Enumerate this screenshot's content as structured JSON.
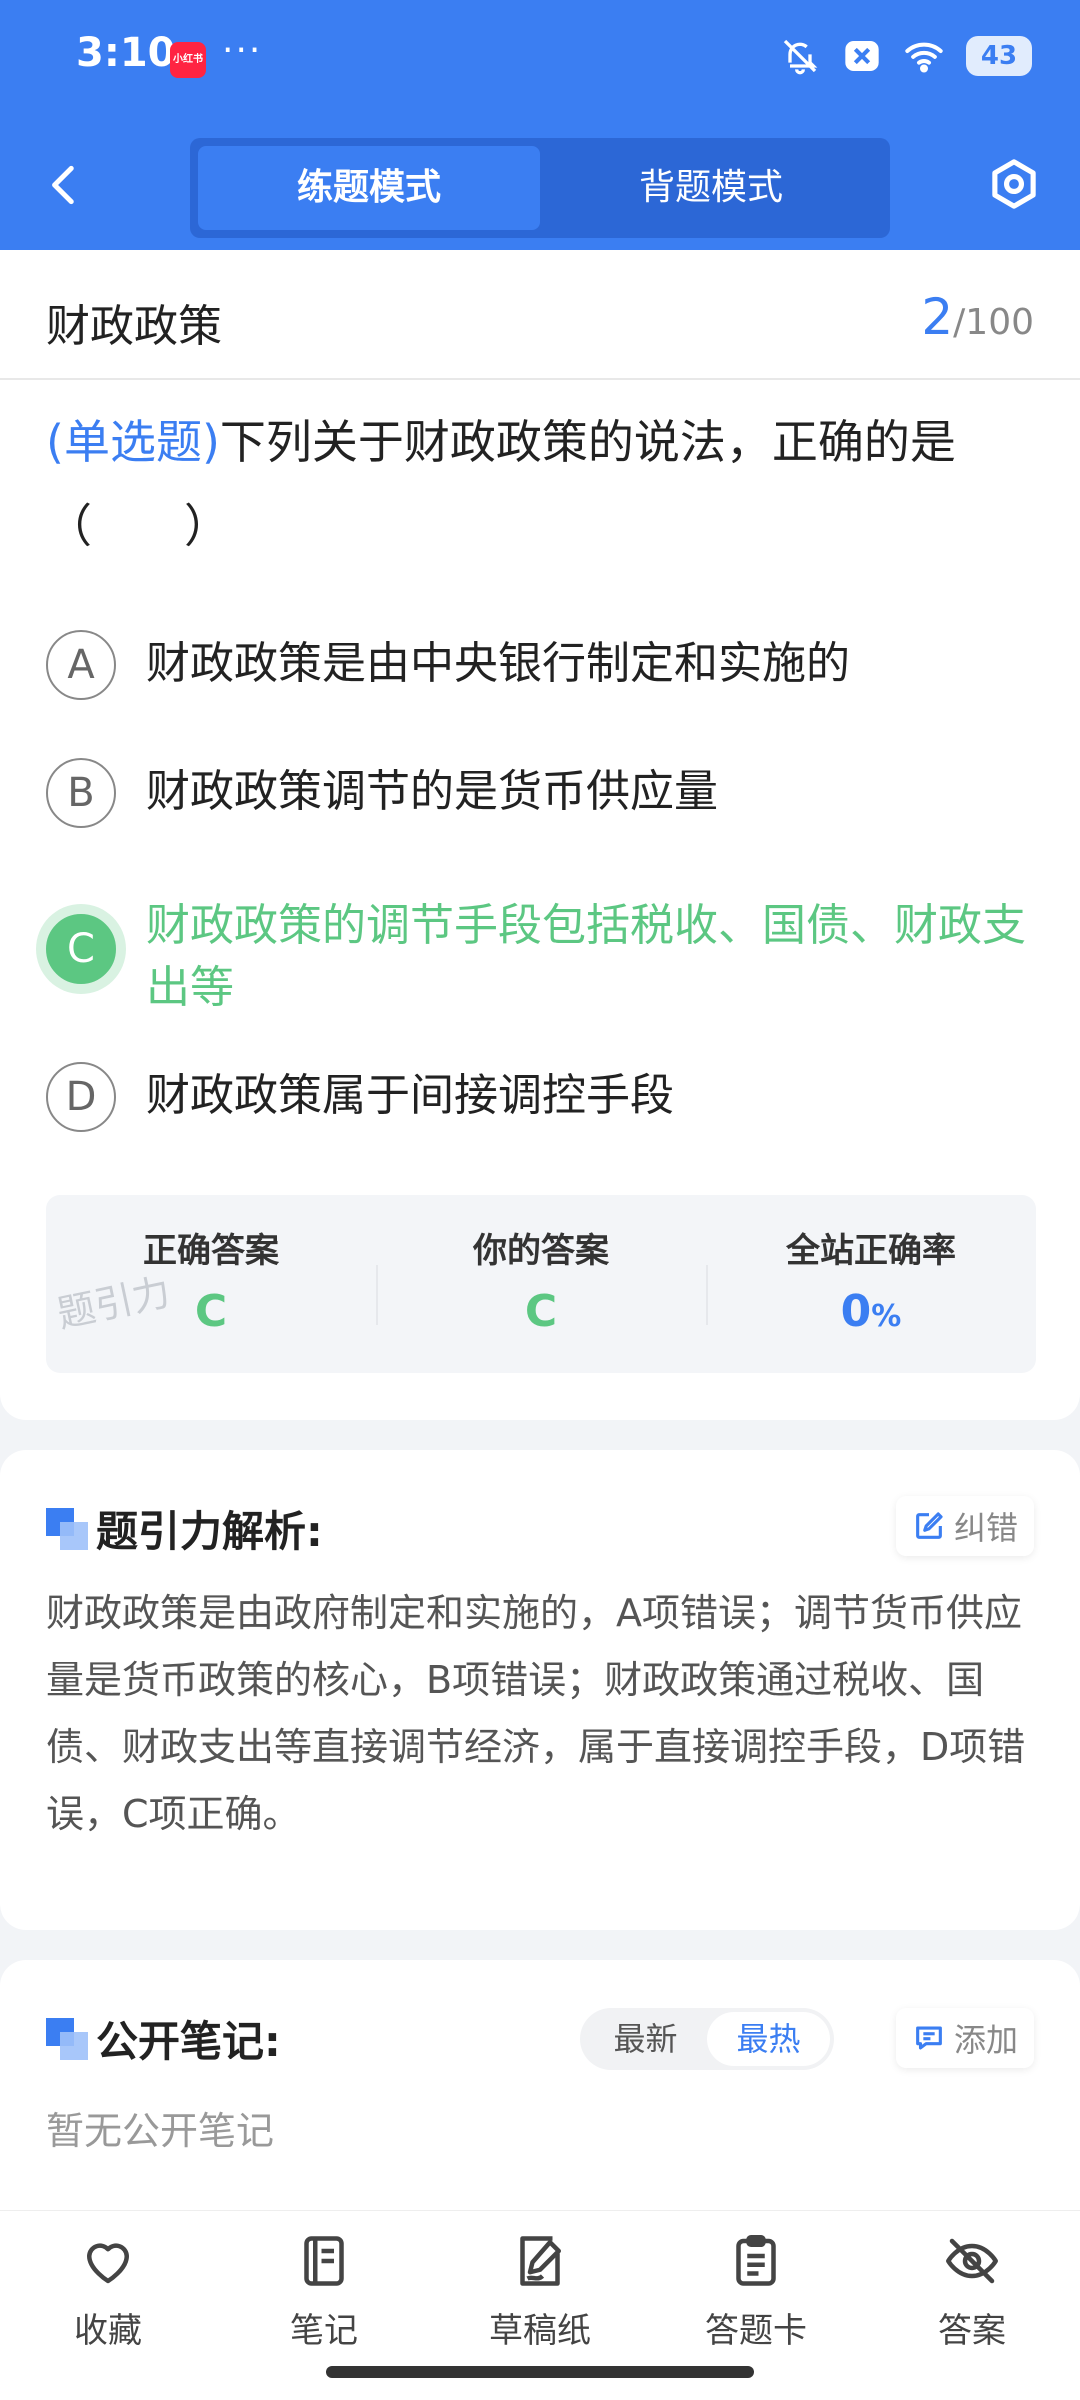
{
  "status_bar": {
    "time": "3:10",
    "app_badge": "小红书",
    "more": "···",
    "battery": "43"
  },
  "nav": {
    "tabs": [
      {
        "label": "练题模式",
        "active": true
      },
      {
        "label": "背题模式",
        "active": false
      }
    ]
  },
  "question": {
    "subject": "财政政策",
    "current": "2",
    "total": "/100",
    "type": "(单选题)",
    "text": "下列关于财政政策的说法，正确的是（　　）",
    "options": [
      {
        "letter": "A",
        "text": "财政政策是由中央银行制定和实施的"
      },
      {
        "letter": "B",
        "text": "财政政策调节的是货币供应量"
      },
      {
        "letter": "C",
        "text": "财政政策的调节手段包括税收、国债、财政支出等",
        "correct": true
      },
      {
        "letter": "D",
        "text": "财政政策属于间接调控手段"
      }
    ]
  },
  "answer_summary": {
    "correct_label": "正确答案",
    "correct_value": "C",
    "yours_label": "你的答案",
    "yours_value": "C",
    "rate_label": "全站正确率",
    "rate_value": "0",
    "rate_unit": "%",
    "watermark": "题引力"
  },
  "analysis": {
    "title": "题引力解析:",
    "report_label": "纠错",
    "text": "财政政策是由政府制定和实施的，A项错误；调节货币供应量是货币政策的核心，B项错误；财政政策通过税收、国债、财政支出等直接调节经济，属于直接调控手段，D项错误，C项正确。"
  },
  "notes": {
    "title": "公开笔记:",
    "sort_options": [
      "最新",
      "最热"
    ],
    "add_label": "添加",
    "empty_text": "暂无公开笔记"
  },
  "bottom_bar": [
    {
      "label": "收藏",
      "icon": "heart-icon"
    },
    {
      "label": "笔记",
      "icon": "notebook-icon"
    },
    {
      "label": "草稿纸",
      "icon": "draft-paper-icon"
    },
    {
      "label": "答题卡",
      "icon": "answer-sheet-icon"
    },
    {
      "label": "答案",
      "icon": "eye-off-icon"
    }
  ],
  "colors": {
    "primary": "#3b7ef2",
    "correct": "#5cc782"
  }
}
